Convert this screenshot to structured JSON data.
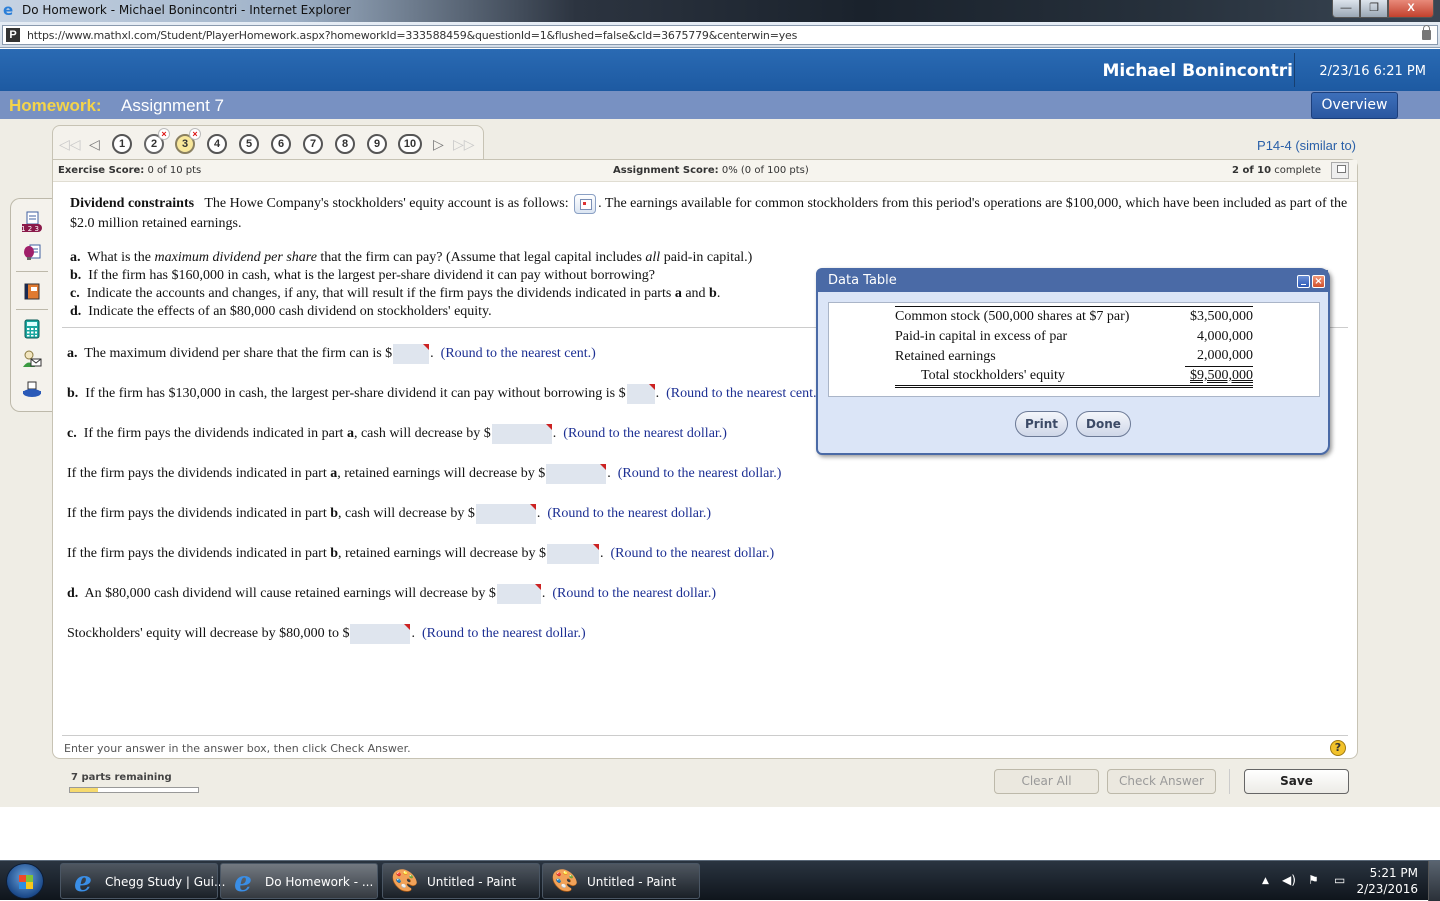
{
  "browser": {
    "title": "Do Homework - Michael Bonincontri - Internet Explorer",
    "url": "https://www.mathxl.com/Student/PlayerHomework.aspx?homeworkId=333588459&questionId=1&flushed=false&cId=3675779&centerwin=yes",
    "window_buttons": {
      "minimize": "—",
      "restore": "❐",
      "close": "X"
    }
  },
  "header": {
    "user_name": "Michael Bonincontri",
    "datetime": "2/23/16 6:21 PM"
  },
  "subheader": {
    "homework_label": "Homework:",
    "assignment_name": "Assignment 7",
    "overview_button": "Overview"
  },
  "question_nav": {
    "first_arrow": "◁◁",
    "prev_arrow": "◁",
    "next_arrow": "▷",
    "last_arrow": "▷▷",
    "questions": [
      {
        "num": "1",
        "status": "normal"
      },
      {
        "num": "2",
        "status": "incorrect"
      },
      {
        "num": "3",
        "status": "current-incorrect"
      },
      {
        "num": "4",
        "status": "normal"
      },
      {
        "num": "5",
        "status": "normal"
      },
      {
        "num": "6",
        "status": "normal"
      },
      {
        "num": "7",
        "status": "normal"
      },
      {
        "num": "8",
        "status": "normal"
      },
      {
        "num": "9",
        "status": "normal"
      },
      {
        "num": "10",
        "status": "normal"
      }
    ],
    "incorrect_mark": "×",
    "reference": "P14-4 (similar to)"
  },
  "scores": {
    "exercise_label": "Exercise Score:",
    "exercise_value": "0 of 10 pts",
    "assignment_label": "Assignment Score:",
    "assignment_value": "0% (0 of 100 pts)",
    "complete_bold": "2 of 10",
    "complete_text": "complete"
  },
  "toolbar_icons": [
    "question-list-icon",
    "help-me-solve-icon",
    "textbook-icon",
    "calculator-icon",
    "ask-instructor-icon",
    "print-icon"
  ],
  "question": {
    "title": "Dividend constraints",
    "intro_before_button": "The Howe Company's stockholders' equity account is as follows:",
    "intro_after_button": ". The earnings available for common stockholders from this period's operations are $100,000, which have been included as part of the $2.0 million retained earnings.",
    "parts": [
      {
        "letter": "a.",
        "segments": [
          "What is the ",
          "maximum dividend per share",
          " that the firm can pay?  (Assume that legal capital includes ",
          "all",
          " paid-in capital.)"
        ]
      },
      {
        "letter": "b.",
        "text": "If the firm has $160,000 in cash, what is the largest per-share dividend it can pay without borrowing?"
      },
      {
        "letter": "c.",
        "text_before": "Indicate the accounts and changes, if any, that will result if the firm pays the dividends indicated in parts ",
        "bold1": "a",
        "mid": " and ",
        "bold2": "b",
        "end": "."
      },
      {
        "letter": "d.",
        "text": "Indicate the effects of an $80,000 cash dividend on stockholders' equity."
      }
    ]
  },
  "answers": [
    {
      "letter": "a.",
      "text": "The maximum dividend per share that the firm can is $",
      "hint": "(Round to the nearest cent.)",
      "value": ""
    },
    {
      "letter": "b.",
      "text": "If the firm has $130,000 in cash, the largest per-share dividend it can pay without borrowing is $",
      "hint": "(Round to the nearest cent.)",
      "value": ""
    },
    {
      "letter": "c.",
      "text": "If the firm pays the dividends indicated in part a, cash will decrease by $",
      "hint": "(Round to the nearest dollar.)",
      "value": ""
    },
    {
      "letter": "",
      "text": "If the firm pays the dividends indicated in part a, retained earnings will decrease by $",
      "hint": "(Round to the nearest dollar.)",
      "value": ""
    },
    {
      "letter": "",
      "text": "If the firm pays the dividends indicated in part b, cash will decrease by $",
      "hint": "(Round to the nearest dollar.)",
      "value": ""
    },
    {
      "letter": "",
      "text": "If the firm pays the dividends indicated in part b, retained earnings will decrease by $",
      "hint": "(Round to the nearest dollar.)",
      "value": ""
    },
    {
      "letter": "d.",
      "text": "An $80,000 cash dividend will cause retained earnings will decrease by $",
      "hint": "(Round to the nearest dollar.)",
      "value": ""
    },
    {
      "letter": "",
      "text": "Stockholders' equity will decrease by $80,000 to $",
      "hint": "(Round to the nearest dollar.)",
      "value": ""
    }
  ],
  "answer_rich": {
    "c_pre": "If the firm pays the dividends indicated in part ",
    "c_bold": "a",
    "c_post": ", cash will decrease by $",
    "r1_pre": "If the firm pays the dividends indicated in part ",
    "r1_bold": "a",
    "r1_post": ", retained earnings will decrease by $",
    "r2_pre": "If the firm pays the dividends indicated in part ",
    "r2_bold": "b",
    "r2_post": ", cash will decrease by $",
    "r3_pre": "If the firm pays the dividends indicated in part ",
    "r3_bold": "b",
    "r3_post": ", retained earnings will decrease by $",
    "period": "."
  },
  "footer": {
    "instruction": "Enter your answer in the answer box, then click Check Answer.",
    "help": "?",
    "parts_remaining": "7 parts remaining",
    "progress_fraction": 0.22,
    "clear_all": "Clear All",
    "check_answer": "Check Answer",
    "save": "Save"
  },
  "data_table_dialog": {
    "title": "Data Table",
    "rows": [
      {
        "label": "Common stock (500,000 shares at $7 par)",
        "amount": "$3,500,000"
      },
      {
        "label": "Paid-in capital in excess of par",
        "amount": "4,000,000"
      },
      {
        "label": "Retained earnings",
        "amount": "2,000,000"
      },
      {
        "label": "Total stockholders' equity",
        "amount": "$9,500,000"
      }
    ],
    "print_button": "Print",
    "done_button": "Done",
    "close_glyph": "×"
  },
  "taskbar": {
    "items": [
      {
        "label": "Chegg Study | Gui...",
        "icon": "ie-icon",
        "active": false
      },
      {
        "label": "Do Homework - ...",
        "icon": "ie-icon",
        "active": true
      },
      {
        "label": "Untitled - Paint",
        "icon": "paint-icon",
        "active": false
      },
      {
        "label": "Untitled - Paint",
        "icon": "paint-icon",
        "active": false
      }
    ],
    "time": "5:21 PM",
    "date": "2/23/2016"
  }
}
